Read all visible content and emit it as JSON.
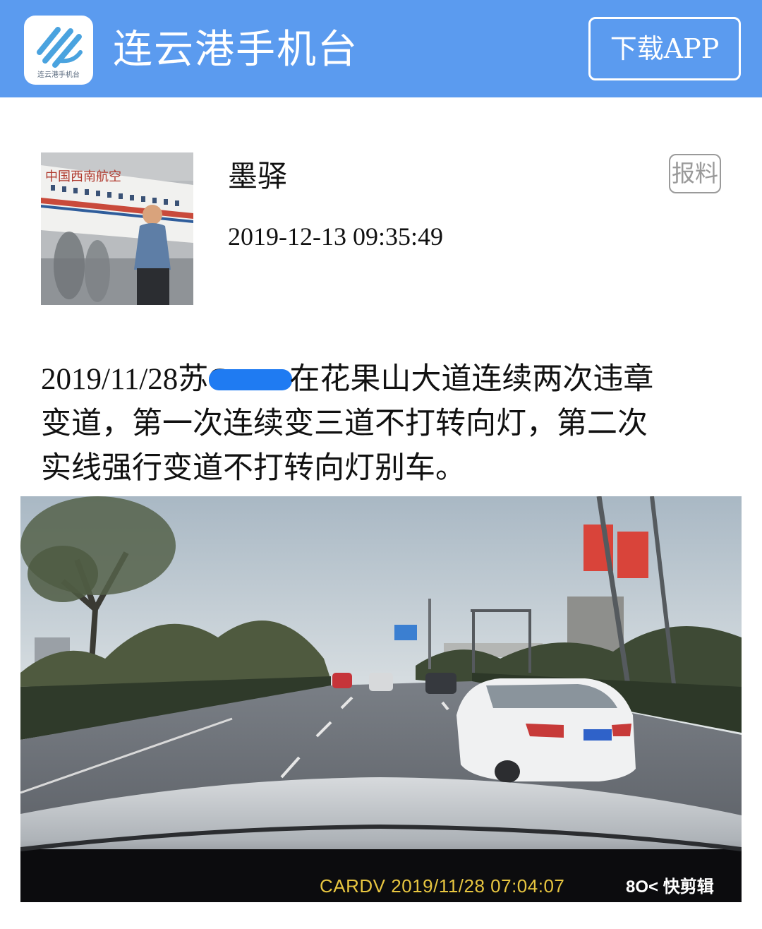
{
  "header": {
    "app_name": "连云港手机台",
    "logo_text": "连云港手机台",
    "download_label": "下载APP",
    "accent_color": "#5b9bef"
  },
  "author": {
    "name": "墨驿",
    "time": "2019-12-13 09:35:49",
    "report_label": "报料",
    "avatar_caption": "中国西南航空"
  },
  "post": {
    "line1_before": "2019/11/28苏G",
    "line1_after": "在花果山大道连续两次违章",
    "line2": "变道，第一次连续变三道不打转向灯，第二次",
    "line3": "实线强行变道不打转向灯别车。",
    "redaction_color": "#1f7bf2"
  },
  "photo": {
    "camera_stamp": "CARDV 2019/11/28 07:04:07",
    "watermark": "8O< 快剪辑"
  }
}
